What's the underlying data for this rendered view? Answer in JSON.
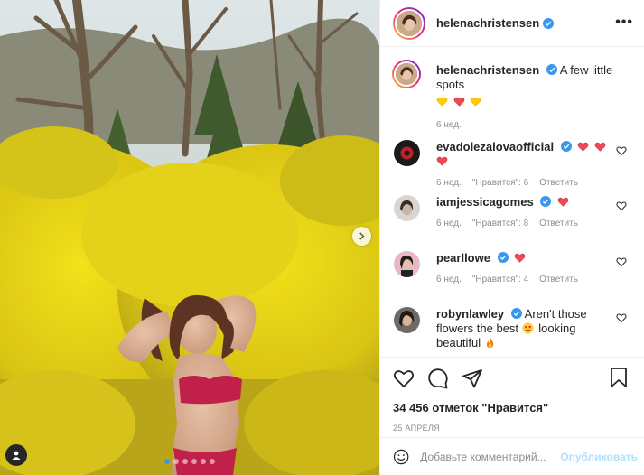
{
  "post": {
    "author": "helenachristensen",
    "more_icon": "ellipsis-icon",
    "caption": {
      "username": "helenachristensen",
      "text": "A few little spots",
      "emoji": [
        "yellow-heart",
        "red-heart",
        "yellow-heart"
      ],
      "time": "6 нед."
    },
    "carousel": {
      "slides": 6,
      "active_index": 0
    }
  },
  "comments": [
    {
      "username": "evadolezalovaofficial",
      "text": "",
      "emoji": [
        "red-heart",
        "red-heart",
        "red-heart"
      ],
      "time": "6 нед.",
      "likes": "\"Нравится\": 6",
      "reply": "Ответить"
    },
    {
      "username": "iamjessicagomes",
      "text": "",
      "emoji": [
        "red-heart"
      ],
      "time": "6 нед.",
      "likes": "\"Нравится\": 8",
      "reply": "Ответить"
    },
    {
      "username": "pearllowe",
      "text": "",
      "emoji": [
        "red-heart"
      ],
      "time": "6 нед.",
      "likes": "\"Нравится\": 4",
      "reply": "Ответить"
    },
    {
      "username": "robynlawley",
      "text_part1": "Aren't those flowers the best",
      "text_part2": "looking beautiful",
      "emoji": [
        "heart-eyes",
        "fire"
      ]
    }
  ],
  "footer": {
    "likes_text": "34 456 отметок \"Нравится\"",
    "date": "25 АПРЕЛЯ",
    "comment_placeholder": "Добавьте комментарий...",
    "publish_label": "Опубликовать"
  },
  "colors": {
    "accent": "#3897f0",
    "publish_disabled": "#b2dffc",
    "heart_red": "#ed4956",
    "heart_yellow": "#ffcc00",
    "text": "#262626",
    "muted": "#8e8e8e"
  }
}
